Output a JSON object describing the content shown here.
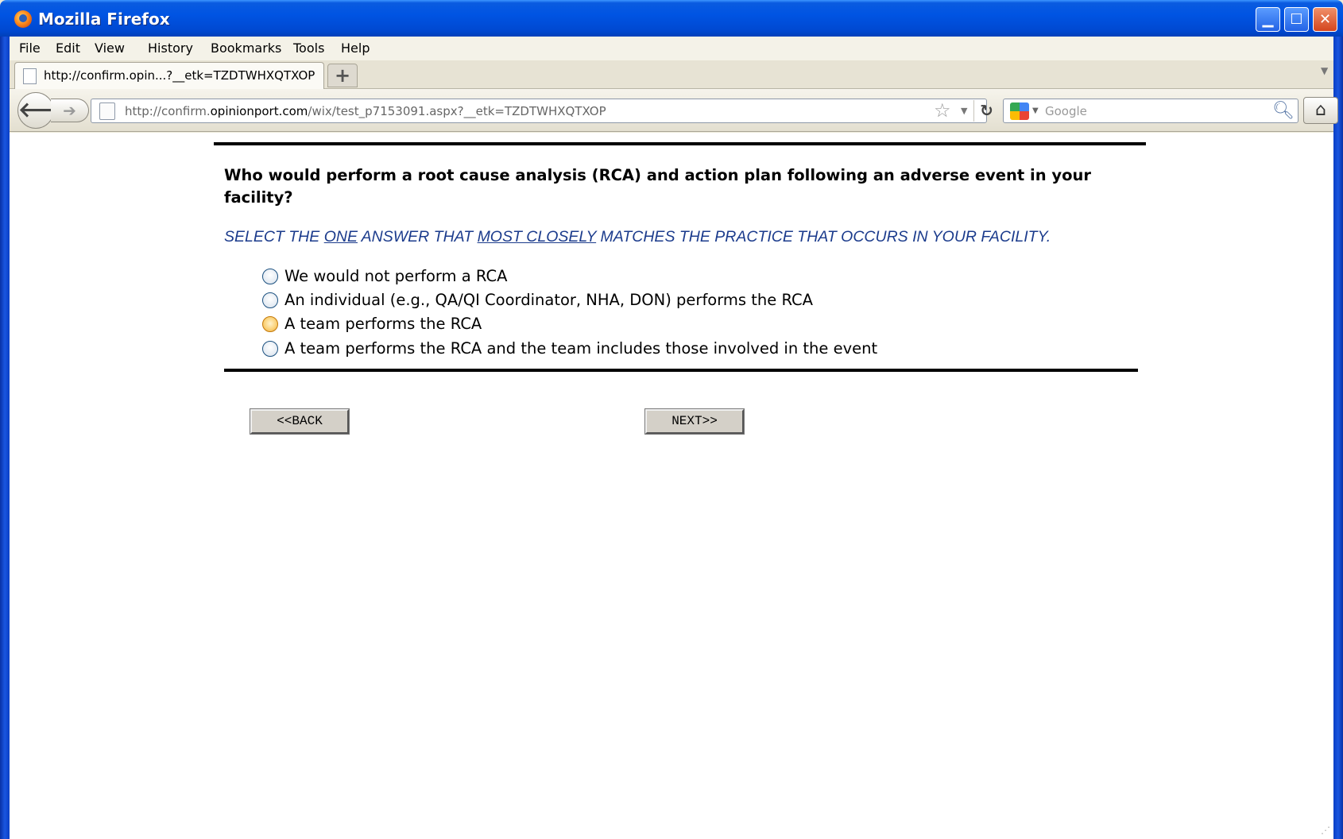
{
  "window": {
    "title": "Mozilla Firefox"
  },
  "menubar": {
    "items": [
      {
        "label": "File"
      },
      {
        "label": "Edit"
      },
      {
        "label": "View"
      },
      {
        "label": "History"
      },
      {
        "label": "Bookmarks"
      },
      {
        "label": "Tools"
      },
      {
        "label": "Help"
      }
    ]
  },
  "tabs": [
    {
      "label": "http://confirm.opin...?__etk=TZDTWHXQTXOP"
    }
  ],
  "navbar": {
    "url_prefix": "http://confirm.",
    "url_host": "opinionport.com",
    "url_suffix": "/wix/test_p7153091.aspx?__etk=TZDTWHXQTXOP",
    "search_placeholder": "Google"
  },
  "survey": {
    "question": "Who would perform a root cause analysis (RCA) and action plan following an adverse event in your facility?",
    "instruction": {
      "part1": "SELECT THE ",
      "em1": "ONE",
      "part2": " ANSWER THAT ",
      "em2": "MOST CLOSELY",
      "part3": " MATCHES THE PRACTICE THAT OCCURS IN YOUR FACILITY."
    },
    "options": [
      {
        "label": "We would not perform a RCA"
      },
      {
        "label": "An individual (e.g., QA/QI Coordinator, NHA, DON) performs the RCA"
      },
      {
        "label": "A team performs the RCA"
      },
      {
        "label": "A team performs the RCA and the team includes those involved in the event"
      }
    ],
    "hovered_option_index": 2,
    "back_label": "<<BACK",
    "next_label": "NEXT>>"
  },
  "icons": {
    "back": "back-arrow-icon",
    "forward": "forward-arrow-icon",
    "reload": "reload-icon",
    "bookmark": "star-icon",
    "search": "magnifier-icon",
    "home": "home-icon",
    "search_engine": "google-icon"
  }
}
